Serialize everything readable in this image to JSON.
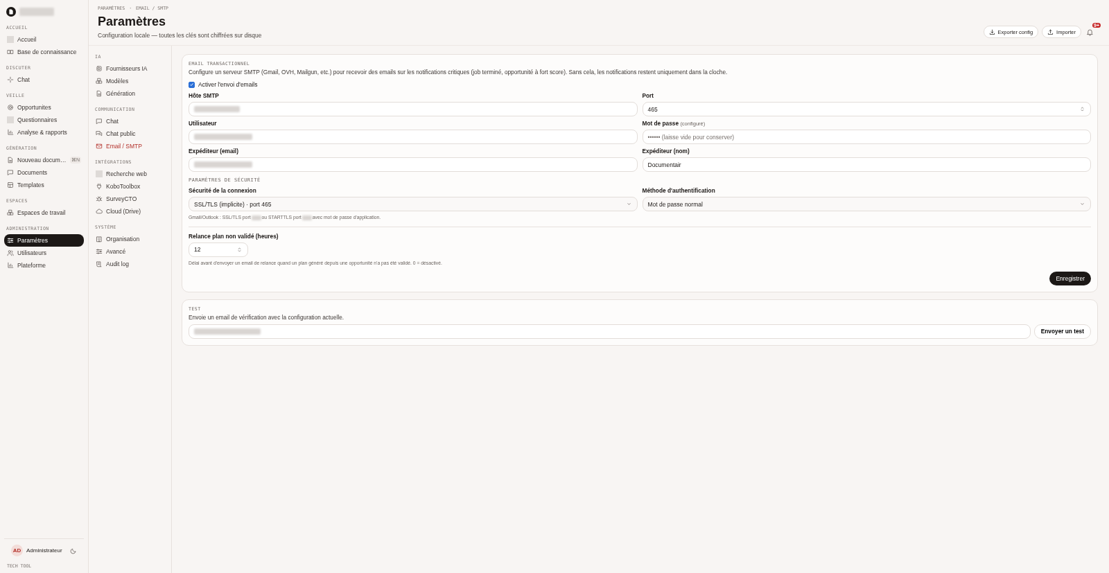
{
  "sidebar": {
    "sections": [
      {
        "title": "ACCUEIL",
        "items": [
          {
            "label": "Accueil",
            "selected": false
          },
          {
            "label": "Base de connaissance",
            "selected": false
          }
        ]
      },
      {
        "title": "DISCUTER",
        "items": [
          {
            "label": "Chat",
            "selected": false
          }
        ]
      },
      {
        "title": "VEILLE",
        "items": [
          {
            "label": "Opportunites",
            "selected": false
          },
          {
            "label": "Questionnaires",
            "selected": false
          },
          {
            "label": "Analyse & rapports",
            "selected": false
          }
        ]
      },
      {
        "title": "GÉNÉRATION",
        "items": [
          {
            "label": "Nouveau docum…",
            "selected": false,
            "shortcut": "⌘N"
          },
          {
            "label": "Documents",
            "selected": false
          },
          {
            "label": "Templates",
            "selected": false
          }
        ]
      },
      {
        "title": "ESPACES",
        "items": [
          {
            "label": "Espaces de travail",
            "selected": false
          }
        ]
      },
      {
        "title": "ADMINISTRATION",
        "items": [
          {
            "label": "Paramètres",
            "selected": true
          },
          {
            "label": "Utilisateurs",
            "selected": false
          },
          {
            "label": "Plateforme",
            "selected": false
          }
        ]
      }
    ],
    "user": {
      "initials": "AD",
      "name": "Administrateur"
    },
    "footer": "TECH TOOL"
  },
  "header": {
    "breadcrumb": [
      "PARAMÈTRES",
      "EMAIL / SMTP"
    ],
    "breadcrumb_separator": "·",
    "title": "Paramètres",
    "subtitle": "Configuration locale — toutes les clés sont chiffrées sur disque",
    "buttons": [
      "Exporter config",
      "Importer"
    ],
    "notifications": "9+"
  },
  "settings_nav": [
    {
      "title": "IA",
      "items": [
        {
          "label": "Fournisseurs IA",
          "selected": false
        },
        {
          "label": "Modèles",
          "selected": false
        },
        {
          "label": "Génération",
          "selected": false
        }
      ]
    },
    {
      "title": "COMMUNICATION",
      "items": [
        {
          "label": "Chat",
          "selected": false
        },
        {
          "label": "Chat public",
          "selected": false
        },
        {
          "label": "Email / SMTP",
          "selected": true
        }
      ]
    },
    {
      "title": "INTÉGRATIONS",
      "items": [
        {
          "label": "Recherche web",
          "selected": false
        },
        {
          "label": "KoboToolbox",
          "selected": false
        },
        {
          "label": "SurveyCTO",
          "selected": false
        },
        {
          "label": "Cloud (Drive)",
          "selected": false
        }
      ]
    },
    {
      "title": "SYSTÈME",
      "items": [
        {
          "label": "Organisation",
          "selected": false
        },
        {
          "label": "Avancé",
          "selected": false
        },
        {
          "label": "Audit log",
          "selected": false
        }
      ]
    }
  ],
  "email_card": {
    "title": "EMAIL TRANSACTIONNEL",
    "description": "Configure un serveur SMTP (Gmail, OVH, Mailgun, etc.) pour recevoir des emails sur les notifications critiques (job terminé, opportunité à fort score). Sans cela, les notifications restent uniquement dans la cloche.",
    "enable": {
      "label": "Activer l'envoi d'emails",
      "checked": true
    },
    "fields": [
      {
        "label": "Hôte SMTP",
        "kind": "text"
      },
      {
        "label": "Port",
        "kind": "number",
        "value": "465"
      },
      {
        "label": "Utilisateur",
        "kind": "text"
      },
      {
        "label": "Mot de passe",
        "note": "(configuré)",
        "kind": "text",
        "placeholder": "•••••• (laisse vide pour conserver)"
      },
      {
        "label": "Expéditeur (email)",
        "kind": "text"
      },
      {
        "label": "Expéditeur (nom)",
        "kind": "text",
        "value": "Documentair"
      }
    ],
    "security_title": "PARAMÈTRES DE SÉCURITÉ",
    "selects": [
      {
        "label": "Sécurité de la connexion",
        "value": "SSL/TLS (implicite) · port 465"
      },
      {
        "label": "Méthode d'authentification",
        "value": "Mot de passe normal"
      }
    ],
    "security_hint": [
      "Gmail/Outlook : SSL/TLS port",
      "ou STARTTLS port",
      "avec mot de passe d'application."
    ],
    "reminder": {
      "label": "Relance plan non validé (heures)",
      "value": "12",
      "hint": "Délai avant d'envoyer un email de relance quand un plan généré depuis une opportunité n'a pas été validé. 0 = désactivé."
    },
    "save": "Enregistrer"
  },
  "test_card": {
    "title": "TEST",
    "description": "Envoie un email de vérification avec la configuration actuelle.",
    "button": "Envoyer un test"
  }
}
